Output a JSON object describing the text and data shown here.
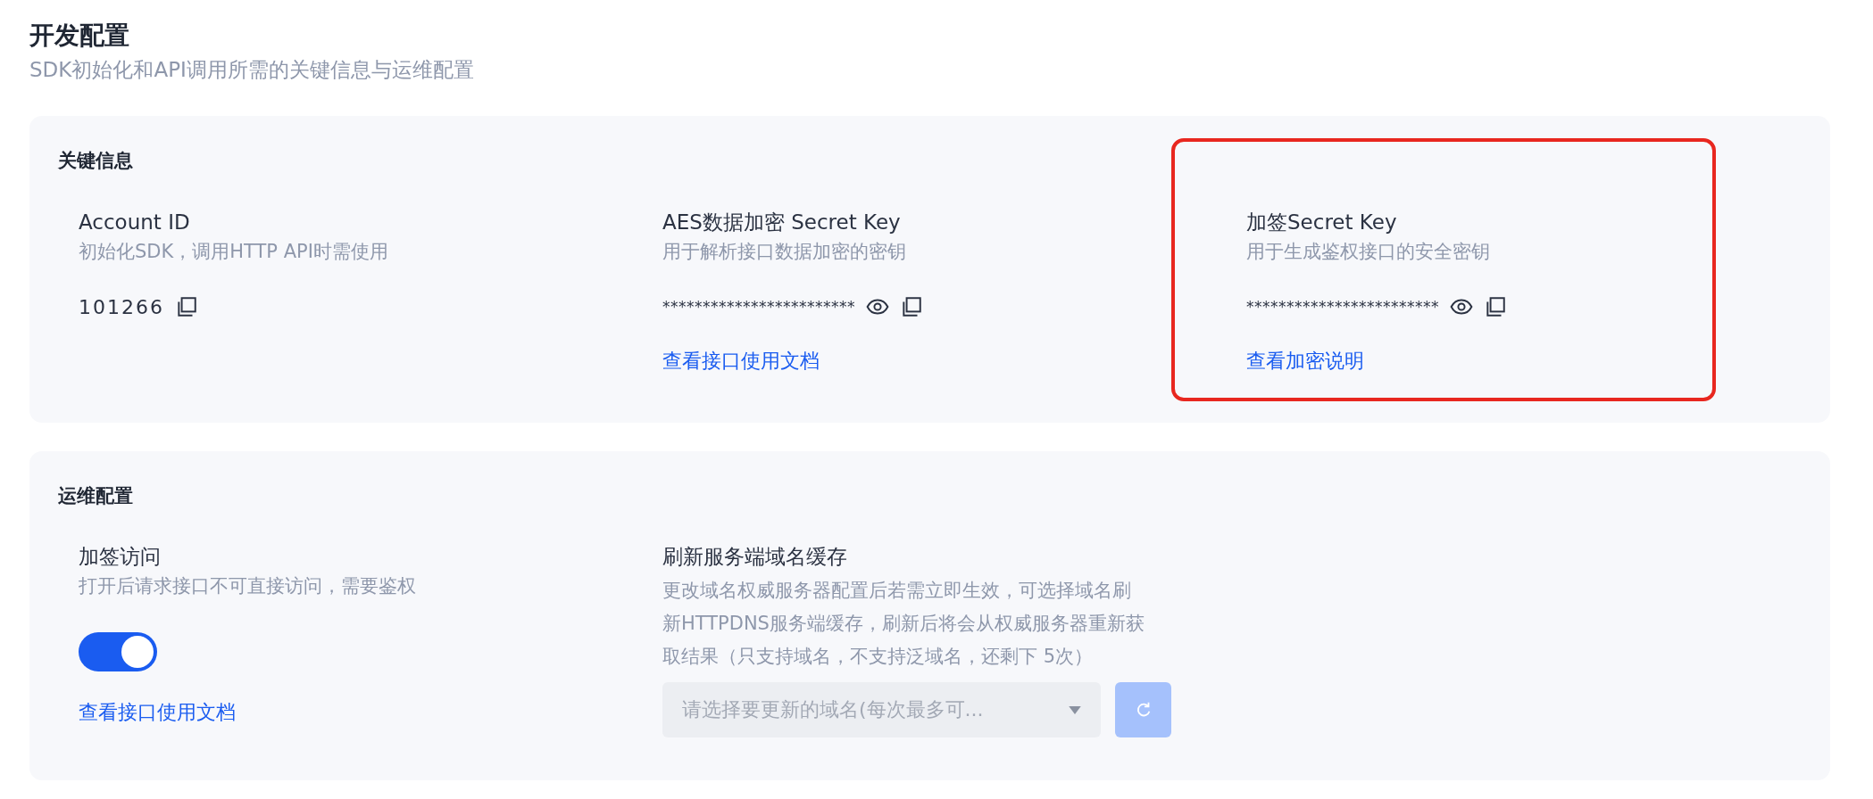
{
  "page": {
    "title": "开发配置",
    "subtitle": "SDK初始化和API调用所需的关键信息与运维配置"
  },
  "key_info": {
    "title": "关键信息",
    "fields": [
      {
        "label": "Account ID",
        "description": "初始化SDK，调用HTTP API时需使用",
        "value": "101266",
        "revealable": false,
        "highlighted": false
      },
      {
        "label": "AES数据加密 Secret Key",
        "description": "用于解析接口数据加密的密钥",
        "value": "************************",
        "revealable": true,
        "link": "查看接口使用文档",
        "highlighted": false
      },
      {
        "label": "加签Secret Key",
        "description": "用于生成鉴权接口的安全密钥",
        "value": "************************",
        "revealable": true,
        "link": "查看加密说明",
        "highlighted": true
      }
    ]
  },
  "ops": {
    "title": "运维配置",
    "signed_access": {
      "label": "加签访问",
      "description": "打开后请求接口不可直接访问，需要鉴权",
      "on": true,
      "link": "查看接口使用文档"
    },
    "refresh_cache": {
      "label": "刷新服务端域名缓存",
      "description": "更改域名权威服务器配置后若需立即生效，可选择域名刷新HTTPDNS服务端缓存，刷新后将会从权威服务器重新获取结果（只支持域名，不支持泛域名，还剩下 5次）",
      "placeholder": "请选择要更新的域名(每次最多可...",
      "refresh_disabled": true
    }
  }
}
